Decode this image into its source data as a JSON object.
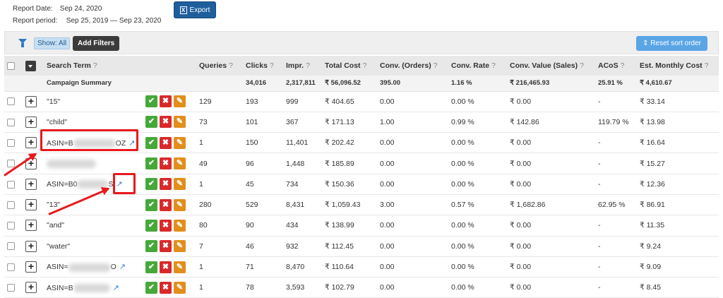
{
  "report": {
    "date_label": "Report Date:",
    "date_value": "Sep 24, 2020",
    "period_label": "Report period:",
    "period_value": "Sep 25, 2019 — Sep 23, 2020"
  },
  "export_label": "Export",
  "toolbar": {
    "show_all": "Show: All",
    "add_filters": "Add Filters",
    "reset_sort": "Reset sort order"
  },
  "columns": {
    "search_term": "Search Term",
    "queries": "Queries",
    "clicks": "Clicks",
    "impr": "Impr.",
    "total_cost": "Total Cost",
    "conv_orders": "Conv. (Orders)",
    "conv_rate": "Conv. Rate",
    "conv_value": "Conv. Value (Sales)",
    "acos": "ACoS",
    "est_monthly": "Est. Monthly Cost",
    "help": "?"
  },
  "summary": {
    "label": "Campaign Summary",
    "clicks": "34,016",
    "impr": "2,317,811",
    "total_cost": "₹ 56,096.52",
    "conv_orders": "395.00",
    "conv_rate": "1.16 %",
    "conv_value": "₹ 216,465.93",
    "acos": "25.91 %",
    "est_monthly": "₹ 4,610.67"
  },
  "rows": [
    {
      "term": "\"15\"",
      "queries": "129",
      "clicks": "193",
      "impr": "999",
      "cost": "₹ 404.65",
      "orders": "0.00",
      "rate": "0.00 %",
      "value": "₹ 0.00",
      "acos": "-",
      "monthly": "₹ 33.14"
    },
    {
      "term": "\"child\"",
      "queries": "73",
      "clicks": "101",
      "impr": "367",
      "cost": "₹ 171.13",
      "orders": "1.00",
      "rate": "0.99 %",
      "value": "₹ 142.86",
      "acos": "119.79 %",
      "monthly": "₹ 13.98"
    },
    {
      "term": "ASIN=B",
      "term_tail": "OZ",
      "queries": "1",
      "clicks": "150",
      "impr": "11,401",
      "cost": "₹ 202.42",
      "orders": "0.00",
      "rate": "0.00 %",
      "value": "₹ 0.00",
      "acos": "-",
      "monthly": "₹ 16.64"
    },
    {
      "term": "",
      "queries": "49",
      "clicks": "96",
      "impr": "1,448",
      "cost": "₹ 185.89",
      "orders": "0.00",
      "rate": "0.00 %",
      "value": "₹ 0.00",
      "acos": "-",
      "monthly": "₹ 15.27"
    },
    {
      "term": "ASIN=B0",
      "term_tail": "S",
      "queries": "1",
      "clicks": "45",
      "impr": "734",
      "cost": "₹ 150.36",
      "orders": "0.00",
      "rate": "0.00 %",
      "value": "₹ 0.00",
      "acos": "-",
      "monthly": "₹ 12.36"
    },
    {
      "term": "\"13\"",
      "queries": "280",
      "clicks": "529",
      "impr": "8,431",
      "cost": "₹ 1,059.43",
      "orders": "3.00",
      "rate": "0.57 %",
      "value": "₹ 1,682.86",
      "acos": "62.95 %",
      "monthly": "₹ 86.91"
    },
    {
      "term": "\"and\"",
      "queries": "80",
      "clicks": "90",
      "impr": "434",
      "cost": "₹ 138.99",
      "orders": "0.00",
      "rate": "0.00 %",
      "value": "₹ 0.00",
      "acos": "-",
      "monthly": "₹ 11.35"
    },
    {
      "term": "\"water\"",
      "queries": "7",
      "clicks": "46",
      "impr": "932",
      "cost": "₹ 112.45",
      "orders": "0.00",
      "rate": "0.00 %",
      "value": "₹ 0.00",
      "acos": "-",
      "monthly": "₹ 9.24"
    },
    {
      "term": "ASIN=",
      "term_tail": "O",
      "queries": "1",
      "clicks": "71",
      "impr": "8,470",
      "cost": "₹ 110.64",
      "orders": "0.00",
      "rate": "0.00 %",
      "value": "₹ 0.00",
      "acos": "-",
      "monthly": "₹ 9.09"
    },
    {
      "term": "ASIN=B",
      "term_tail": "",
      "queries": "1",
      "clicks": "78",
      "impr": "3,593",
      "cost": "₹ 102.79",
      "orders": "0.00",
      "rate": "0.00 %",
      "value": "₹ 0.00",
      "acos": "-",
      "monthly": "₹ 8.45"
    }
  ],
  "accent_colors": {
    "highlight": "#e8191c",
    "approve": "#45a93a",
    "reject": "#d9292b",
    "edit": "#e28e1c"
  }
}
